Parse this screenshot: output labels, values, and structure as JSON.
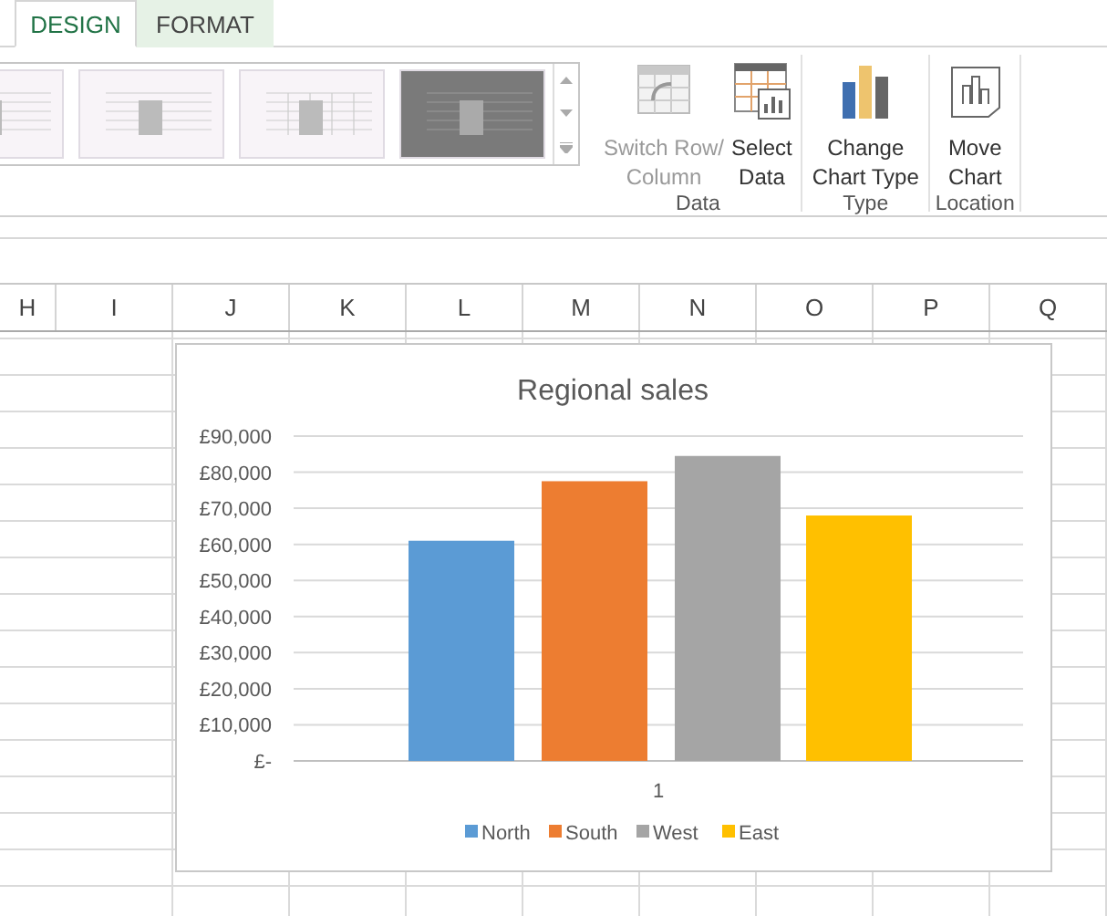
{
  "tabs": [
    {
      "label": "DESIGN",
      "selected": true
    },
    {
      "label": "FORMAT",
      "selected": false
    }
  ],
  "ribbon": {
    "chart_styles": [
      {
        "kind": "light",
        "selected": false
      },
      {
        "kind": "light",
        "selected": false
      },
      {
        "kind": "grid",
        "selected": false
      },
      {
        "kind": "dark",
        "selected": false
      }
    ],
    "groups": [
      {
        "label": "Data",
        "buttons": [
          {
            "kind": "switch",
            "lines": [
              "Switch Row/",
              "Column"
            ],
            "disabled": true
          },
          {
            "kind": "select",
            "lines": [
              "Select",
              "Data"
            ],
            "disabled": false
          }
        ]
      },
      {
        "label": "Type",
        "buttons": [
          {
            "kind": "change",
            "lines": [
              "Change",
              "Chart Type"
            ],
            "disabled": false
          }
        ]
      },
      {
        "label": "Location",
        "buttons": [
          {
            "kind": "move",
            "lines": [
              "Move",
              "Chart"
            ],
            "disabled": false
          }
        ]
      }
    ]
  },
  "sheet": {
    "columns": [
      "H",
      "I",
      "J",
      "K",
      "L",
      "M",
      "N",
      "O",
      "P",
      "Q"
    ]
  },
  "chart": {
    "chart_data": {
      "type": "bar",
      "title": "Regional sales",
      "categories": [
        "1"
      ],
      "series": [
        {
          "name": "North",
          "color": "#5b9bd5",
          "values": [
            61000
          ]
        },
        {
          "name": "South",
          "color": "#ed7d31",
          "values": [
            77500
          ]
        },
        {
          "name": "West",
          "color": "#a5a5a5",
          "values": [
            84500
          ]
        },
        {
          "name": "East",
          "color": "#ffc000",
          "values": [
            68000
          ]
        }
      ],
      "ylim": [
        0,
        90000
      ],
      "grid": true,
      "legend": true,
      "yticks": [
        {
          "value": 0,
          "label": "£-"
        },
        {
          "value": 10000,
          "label": "£10,000"
        },
        {
          "value": 20000,
          "label": "£20,000"
        },
        {
          "value": 30000,
          "label": "£30,000"
        },
        {
          "value": 40000,
          "label": "£40,000"
        },
        {
          "value": 50000,
          "label": "£50,000"
        },
        {
          "value": 60000,
          "label": "£60,000"
        },
        {
          "value": 70000,
          "label": "£70,000"
        },
        {
          "value": 80000,
          "label": "£80,000"
        },
        {
          "value": 90000,
          "label": "£90,000"
        }
      ]
    }
  }
}
